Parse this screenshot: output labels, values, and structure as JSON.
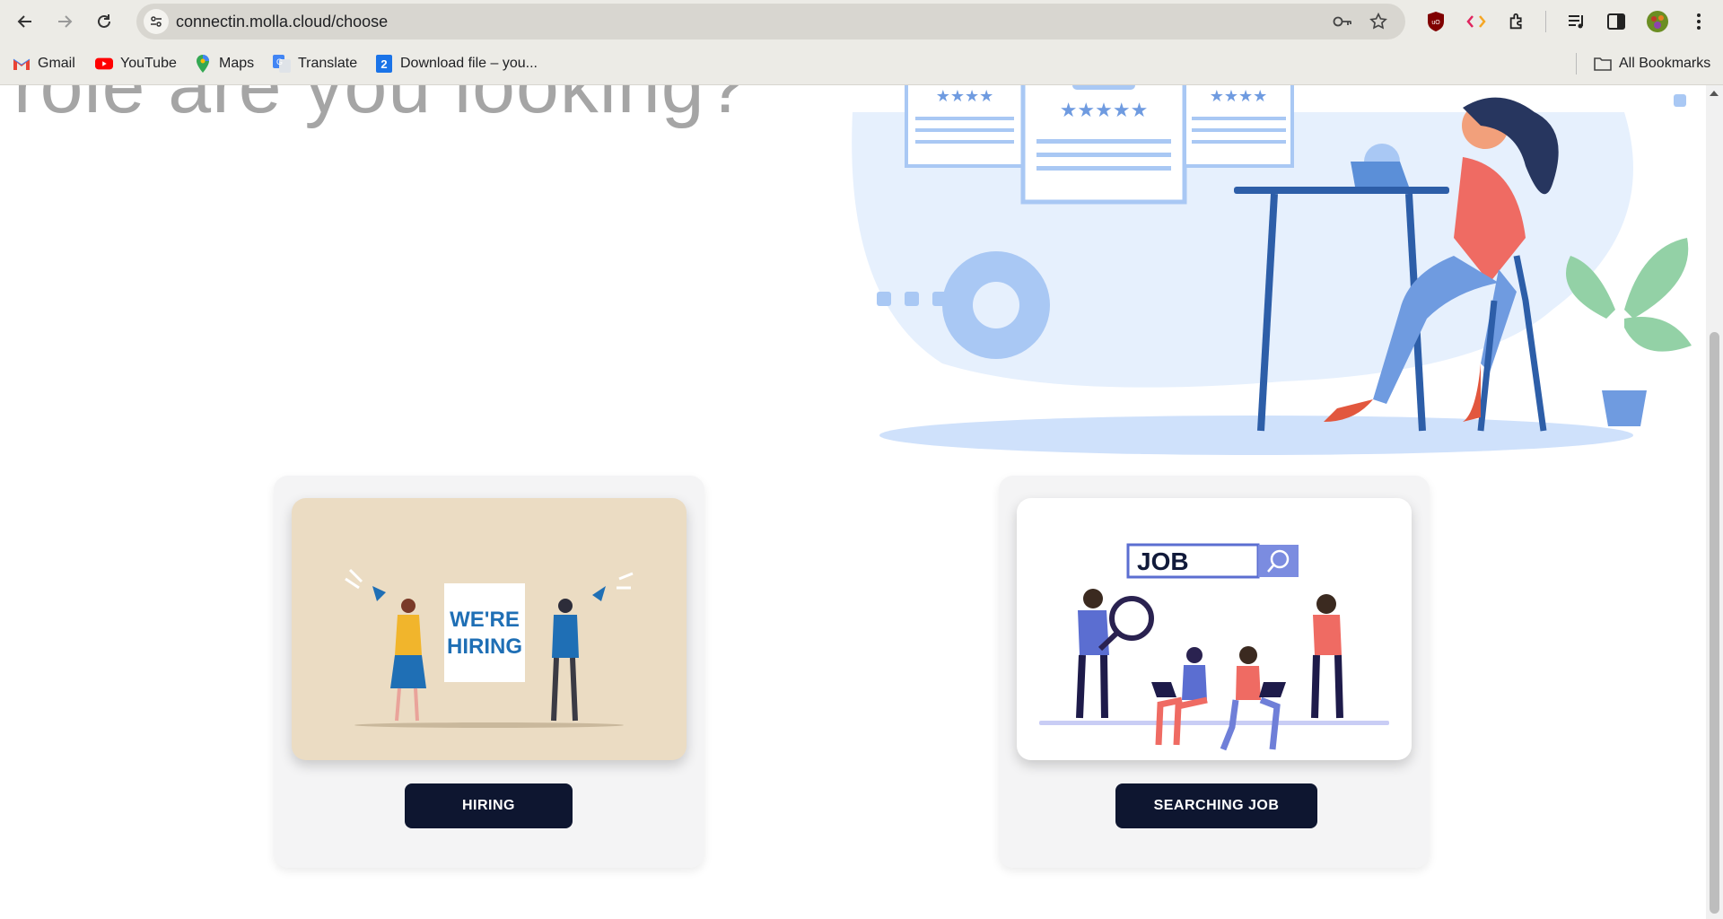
{
  "browser": {
    "url": "connectin.molla.cloud/choose",
    "bookmarks": [
      {
        "label": "Gmail",
        "icon": "gmail-icon"
      },
      {
        "label": "YouTube",
        "icon": "youtube-icon"
      },
      {
        "label": "Maps",
        "icon": "maps-icon"
      },
      {
        "label": "Translate",
        "icon": "translate-icon"
      },
      {
        "label": "Download file – you...",
        "icon": "download-file-icon"
      }
    ],
    "all_bookmarks_label": "All Bookmarks"
  },
  "hero": {
    "heading_fragment": "role are you looking?"
  },
  "cards": [
    {
      "button_label": "HIRING",
      "illustration_text": "WE'RE HIRING"
    },
    {
      "button_label": "SEARCHING JOB",
      "illustration_text": "JOB"
    }
  ],
  "colors": {
    "button_bg": "#0e1630",
    "card_bg": "#f4f4f5",
    "hero_blob": "#e6f0fd",
    "accent_blue": "#2d5ea8"
  }
}
